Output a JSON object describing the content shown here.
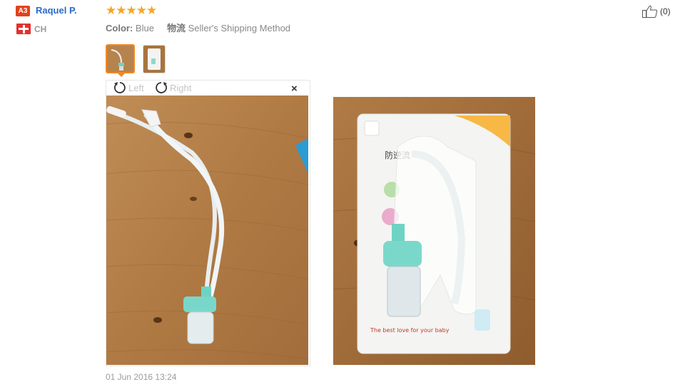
{
  "reviewer": {
    "badge": "A3",
    "name": "Raquel P.",
    "country": "CH"
  },
  "review": {
    "stars": [
      "★",
      "★",
      "★",
      "★",
      "★"
    ],
    "rating": 5,
    "color_label": "Color:",
    "color_value": "Blue",
    "shipping_label": "物流",
    "shipping_value": "Seller's Shipping Method",
    "date": "01 Jun 2016 13:24"
  },
  "viewer": {
    "rotate_left": "Left",
    "rotate_right": "Right",
    "close": "×"
  },
  "helpful": {
    "count": "(0)"
  },
  "packaging_text": {
    "title": "防逆流",
    "tagline": "The best love for your baby"
  },
  "colors": {
    "brand_link": "#2a6ac6",
    "star": "#f5a623",
    "active_thumb": "#f08a24",
    "badge": "#e2411c"
  }
}
